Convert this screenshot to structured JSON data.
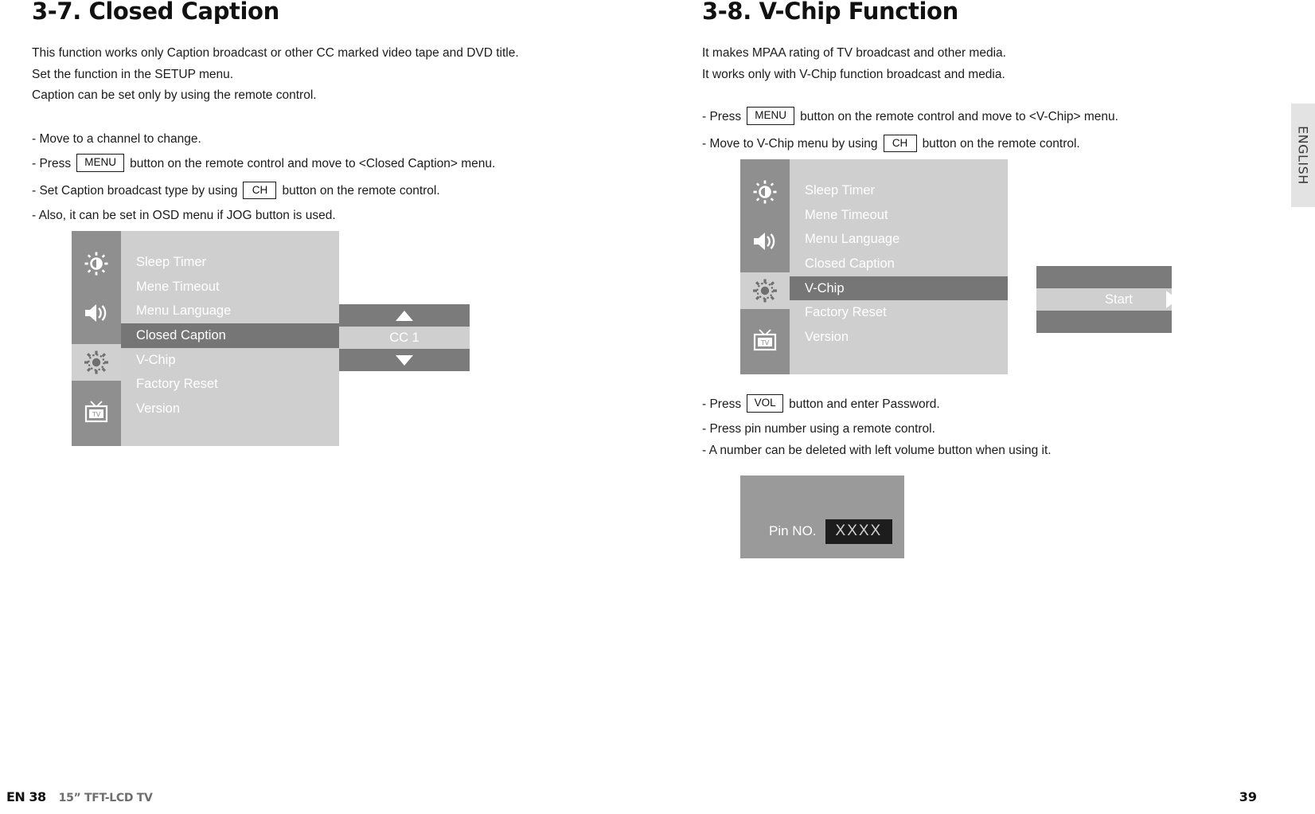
{
  "left_column": {
    "title": "3-7. Closed Caption",
    "intro": [
      "This function works only Caption broadcast or other CC marked video tape and DVD title.",
      "Set the function in the SETUP menu.",
      "Caption can be set only by using the remote control."
    ],
    "bullets": [
      {
        "text_before": "- Move to a channel to change.",
        "key": "",
        "text_after": ""
      },
      {
        "text_before": "- Press",
        "key": "MENU",
        "text_after": "button on the remote control and move to <Closed Caption> menu."
      },
      {
        "text_before": "- Set Caption broadcast type by using",
        "key": "CH",
        "text_after": "button on the remote control."
      },
      {
        "text_before": "- Also, it can be set in OSD menu if JOG button is used.",
        "key": "",
        "text_after": ""
      }
    ],
    "osd": {
      "items": [
        "Sleep Timer",
        "Mene Timeout",
        "Menu Language",
        "Closed Caption",
        "V-Chip",
        "Factory Reset",
        "Version"
      ],
      "selected_index": 3,
      "icons": [
        "brightness-icon",
        "volume-icon",
        "setup-icon",
        "tv-icon"
      ],
      "active_icon_index": 2,
      "value_panel": {
        "type": "updown",
        "value": "CC 1",
        "up_icon": "triangle-up-icon",
        "down_icon": "triangle-down-icon"
      }
    }
  },
  "right_column": {
    "title": "3-8. V-Chip Function",
    "intro": [
      "It makes MPAA rating of TV broadcast and other media.",
      "It works only with V-Chip function broadcast and media."
    ],
    "bullets_top": [
      {
        "text_before": "- Press",
        "key": "MENU",
        "text_after": "button on the remote control and move to <V-Chip> menu."
      },
      {
        "text_before": "- Move to V-Chip menu by using",
        "key": "CH",
        "text_after": "button on the remote control."
      }
    ],
    "osd": {
      "items": [
        "Sleep Timer",
        "Mene Timeout",
        "Menu Language",
        "Closed Caption",
        "V-Chip",
        "Factory Reset",
        "Version"
      ],
      "selected_index": 4,
      "icons": [
        "brightness-icon",
        "volume-icon",
        "setup-icon",
        "tv-icon"
      ],
      "active_icon_index": 2,
      "value_panel": {
        "type": "action",
        "value": "Start",
        "arrow_icon": "triangle-right-icon"
      }
    },
    "bullets_bottom": [
      {
        "text_before": "- Press",
        "key": "VOL",
        "text_after": "button and enter Password."
      },
      {
        "text_before": "- Press pin number using a remote control.",
        "key": "",
        "text_after": ""
      },
      {
        "text_before": "- A number can be deleted with left volume button when using it.",
        "key": "",
        "text_after": ""
      }
    ],
    "pin_dialog": {
      "label": "Pin NO.",
      "value": "XXXX"
    }
  },
  "side_tab": {
    "label": "ENGLISH"
  },
  "footer": {
    "left_page": "EN 38",
    "model": "15” TFT-LCD TV",
    "right_page": "39"
  },
  "colors": {
    "osd_sidebar": "#8f8f8f",
    "osd_panel": "#cfcfcf",
    "osd_selected": "#767676",
    "value_bar": "#7b7b7b",
    "pin_box": "#9a9a9a",
    "pin_field": "#1d1d1d",
    "side_tab": "#e3e3e3"
  }
}
